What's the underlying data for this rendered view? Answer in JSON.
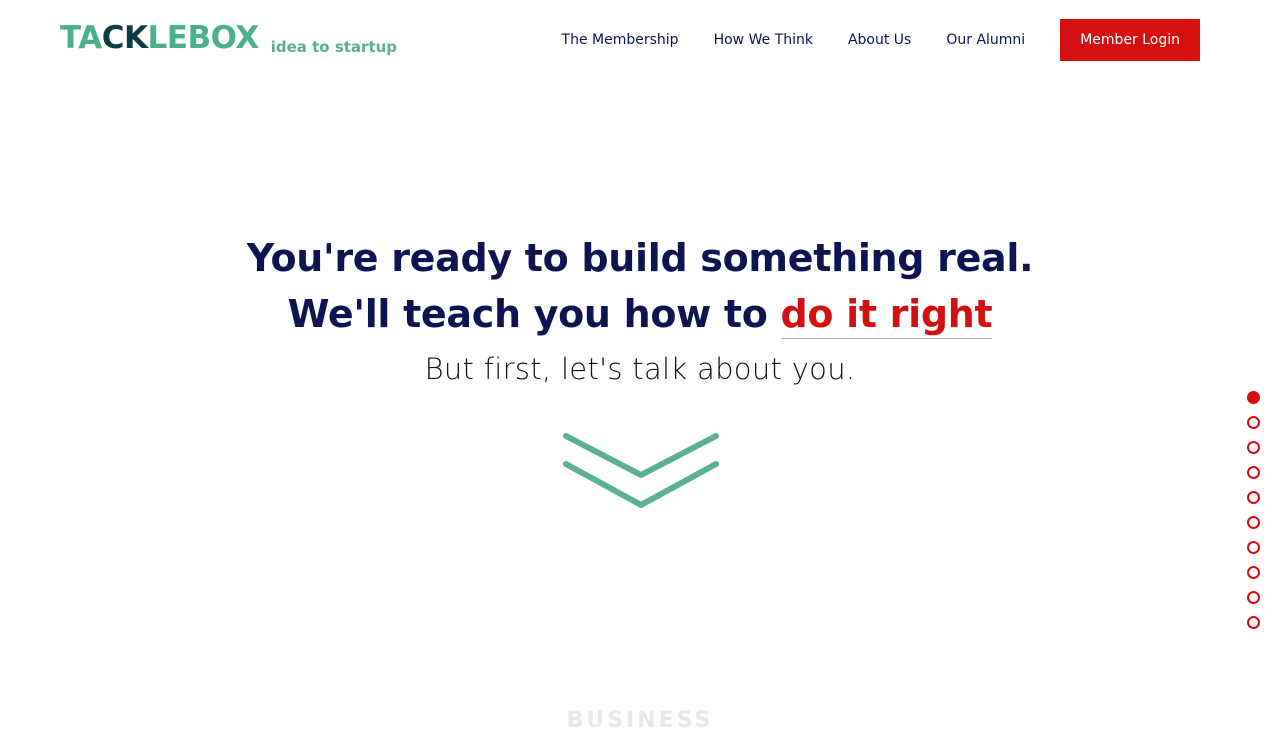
{
  "header": {
    "logo_part1": "TA",
    "logo_part2": "CK",
    "logo_part3": "LE",
    "logo_part4": "BOX",
    "tagline": "idea to startup",
    "nav": [
      {
        "label": "The Membership"
      },
      {
        "label": "How We Think"
      },
      {
        "label": "About Us"
      },
      {
        "label": "Our Alumni"
      }
    ],
    "login_label": "Member Login"
  },
  "hero": {
    "line1": "You're ready to build something real.",
    "line2_prefix": "We'll teach you how to ",
    "line2_accent": "do it right",
    "subtitle": "But first, let's talk about you."
  },
  "next_section_peek": "BUSINESS",
  "section_dots": {
    "count": 10,
    "active_index": 0
  },
  "colors": {
    "navy": "#0d1451",
    "red": "#d40f0f",
    "green": "#5bb08e",
    "logo_dark": "#0f3b43"
  },
  "icons": {
    "scroll_down": "double-chevron-down-icon"
  }
}
